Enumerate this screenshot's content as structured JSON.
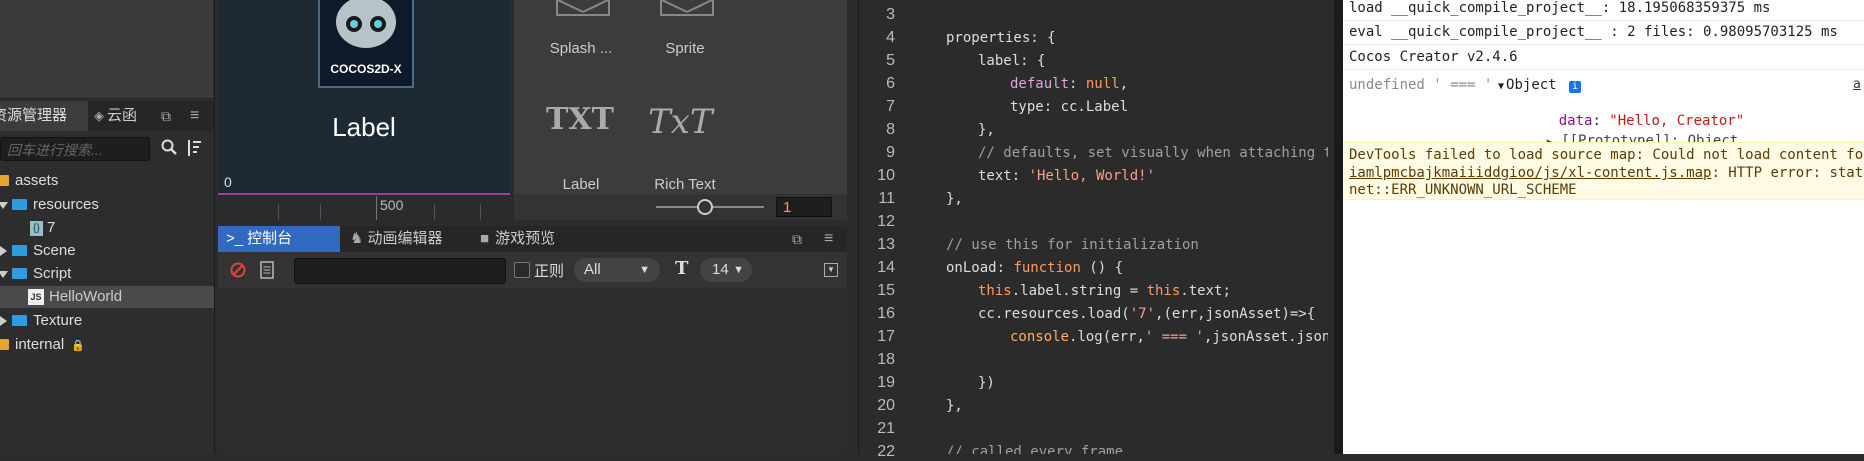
{
  "assets": {
    "tabs": [
      {
        "label": "资源管理器"
      },
      {
        "label": "云函"
      }
    ],
    "search_placeholder": "回车进行搜索...",
    "tree": [
      {
        "label": "assets"
      },
      {
        "label": "resources"
      },
      {
        "label": "7"
      },
      {
        "label": "Scene"
      },
      {
        "label": "Script"
      },
      {
        "label": "HelloWorld"
      },
      {
        "label": "Texture"
      },
      {
        "label": "internal"
      }
    ],
    "file_badge_js": "JS"
  },
  "scene": {
    "logo_text": "COCOS2D-X",
    "label_text": "Label",
    "ruler_left": "0",
    "ruler_mid": "500"
  },
  "palette": {
    "items": [
      {
        "label": "Splash ..."
      },
      {
        "label": "Sprite"
      },
      {
        "label": "Label",
        "glyph": "TXT"
      },
      {
        "label": "Rich Text",
        "glyph": "TxT"
      }
    ],
    "zoom_value": "1"
  },
  "console": {
    "tabs": [
      {
        "label": "控制台"
      },
      {
        "label": "动画编辑器"
      },
      {
        "label": "游戏预览"
      }
    ],
    "regex_label": "正则",
    "level_select": "All",
    "font_size": "14"
  },
  "editor": {
    "line_numbers": [
      "3",
      "4",
      "5",
      "6",
      "7",
      "8",
      "9",
      "10",
      "11",
      "12",
      "13",
      "14",
      "15",
      "16",
      "17",
      "18",
      "19",
      "20",
      "21",
      "22"
    ]
  },
  "devtools": {
    "line1": "load __quick_compile_project__: 18.195068359375 ms",
    "line2": "eval __quick_compile_project__ : 2 files: 0.98095703125 ms",
    "line3": "Cocos Creator v2.4.6",
    "log_prefix": "undefined ' === '",
    "object_label": "Object",
    "info_badge": "i",
    "data_key": "data",
    "data_value": "\"Hello, Creator\"",
    "proto_label": "[[Prototype]]: Object",
    "source_link": "a",
    "warn_line1": "DevTools failed to load source map: Could not load content for",
    "warn_link": "iamlpmcbajkmaiiiddgioo/js/xl-content.js.map",
    "warn_line2_rest": ": HTTP error: status",
    "warn_line3": "net::ERR_UNKNOWN_URL_SCHEME"
  },
  "colors": {
    "accent_blue": "#2f9be0",
    "folder_yellow": "#e5a62d",
    "console_tab_active": "#3069c0",
    "scene_bg": "#1e2a33"
  }
}
